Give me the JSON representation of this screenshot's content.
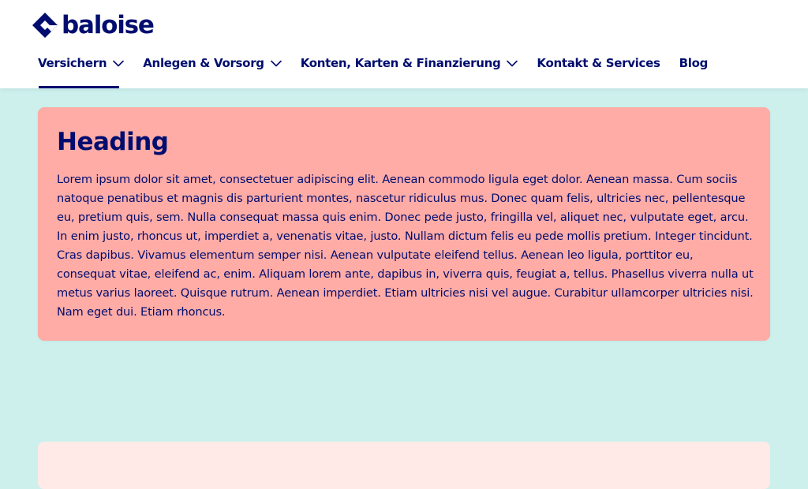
{
  "brand": {
    "name": "baloise",
    "color": "#000d6e"
  },
  "nav": {
    "items": [
      {
        "label": "Versichern",
        "has_dropdown": true,
        "active": true
      },
      {
        "label": "Anlegen & Vorsorg",
        "has_dropdown": true,
        "active": false
      },
      {
        "label": "Konten, Karten & Finanzierung",
        "has_dropdown": true,
        "active": false
      },
      {
        "label": "Kontakt & Services",
        "has_dropdown": false,
        "active": false
      },
      {
        "label": "Blog",
        "has_dropdown": false,
        "active": false
      }
    ]
  },
  "card": {
    "heading": "Heading",
    "body": "Lorem ipsum dolor sit amet, consectetuer adipiscing elit. Aenean commodo ligula eget dolor. Aenean massa. Cum sociis natoque penatibus et magnis dis parturient montes, nascetur ridiculus mus. Donec quam felis, ultricies nec, pellentesque eu, pretium quis, sem. Nulla consequat massa quis enim. Donec pede justo, fringilla vel, aliquet nec, vulputate eget, arcu. In enim justo, rhoncus ut, imperdiet a, venenatis vitae, justo. Nullam dictum felis eu pede mollis pretium. Integer tincidunt. Cras dapibus. Vivamus elementum semper nisi. Aenean vulputate eleifend tellus. Aenean leo ligula, porttitor eu, consequat vitae, eleifend ac, enim. Aliquam lorem ante, dapibus in, viverra quis, feugiat a, tellus. Phasellus viverra nulla ut metus varius laoreet. Quisque rutrum. Aenean imperdiet. Etiam ultricies nisi vel augue. Curabitur ullamcorper ultricies nisi. Nam eget dui. Etiam rhoncus.",
    "background": "#ffaca6"
  },
  "colors": {
    "page_background": "#cdf0ed",
    "header_background": "#ffffff",
    "text_primary": "#000d6e"
  }
}
